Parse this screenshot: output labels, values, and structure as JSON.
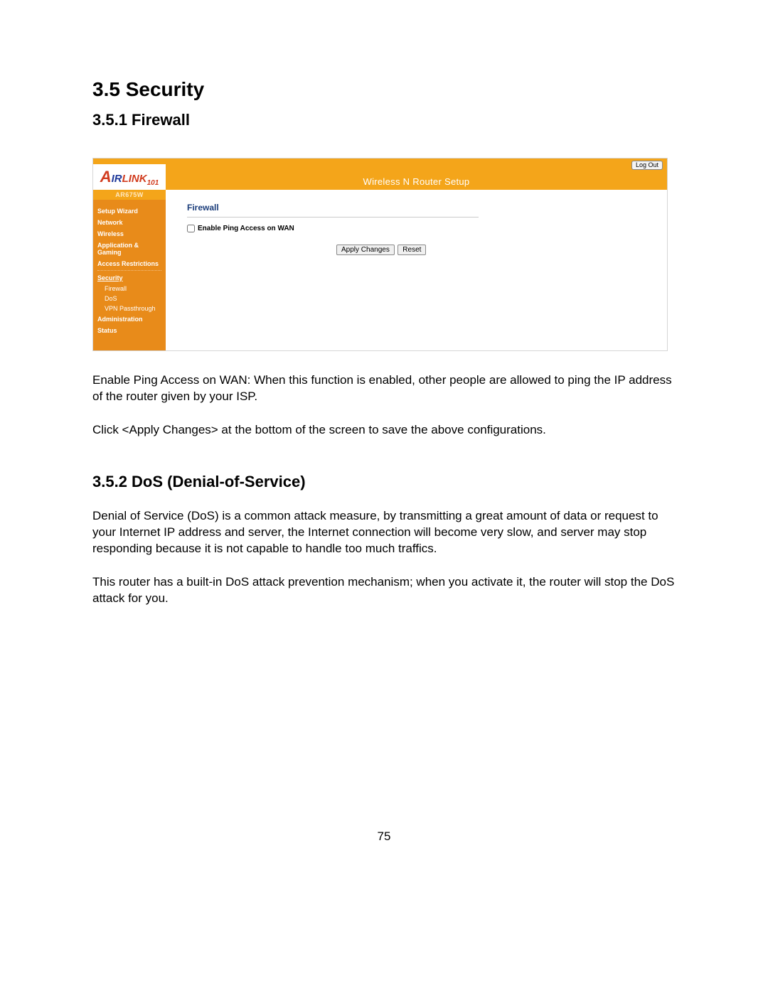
{
  "doc": {
    "section_title": "3.5 Security",
    "sub1_title": "3.5.1 Firewall",
    "para1": "Enable Ping Access on WAN: When this function is enabled, other people are allowed to ping the IP address of the router given by your ISP.",
    "para2": "Click <Apply Changes> at the bottom of the screen to save the above configurations.",
    "sub2_title": "3.5.2 DoS (Denial-of-Service)",
    "para3": "Denial of Service (DoS) is a common attack measure, by transmitting a great amount of data or request to your Internet IP address and server, the Internet connection will become very slow, and server may stop responding because it is not capable to handle too much traffics.",
    "para4": "This router has a built-in DoS attack prevention mechanism; when you activate it, the router will stop the DoS attack for you.",
    "page_number": "75"
  },
  "router": {
    "logout": "Log Out",
    "header_title": "Wireless N Router Setup",
    "model": "AR675W",
    "nav": {
      "setup_wizard": "Setup Wizard",
      "network": "Network",
      "wireless": "Wireless",
      "app_gaming": "Application & Gaming",
      "access_restrictions": "Access Restrictions",
      "security": "Security",
      "sub_firewall": "Firewall",
      "sub_dos": "DoS",
      "sub_vpn": "VPN Passthrough",
      "administration": "Administration",
      "status": "Status"
    },
    "content": {
      "title": "Firewall",
      "checkbox_label": "Enable Ping Access on WAN",
      "apply_btn": "Apply Changes",
      "reset_btn": "Reset"
    }
  }
}
